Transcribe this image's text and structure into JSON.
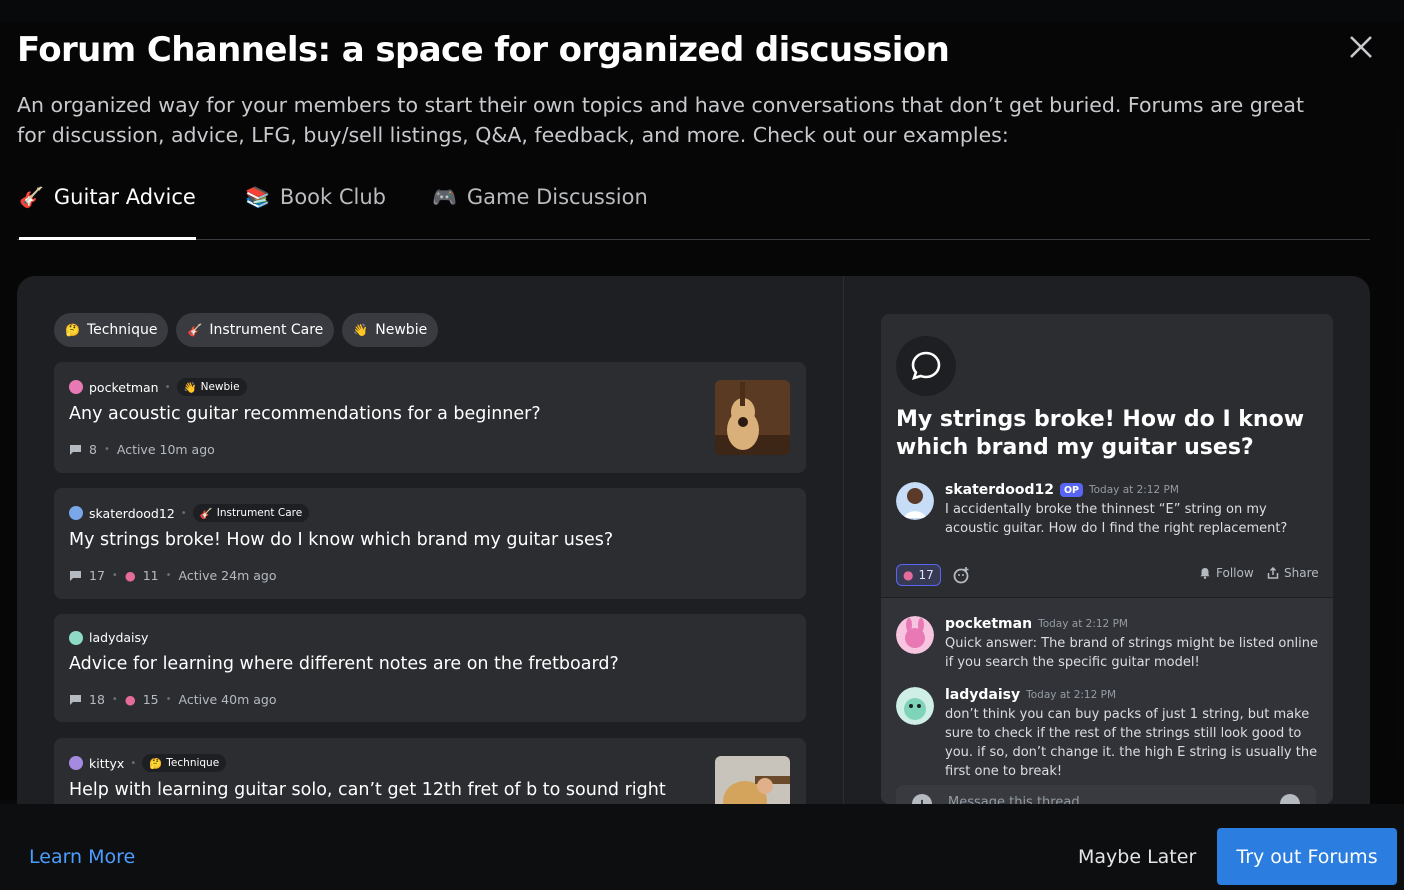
{
  "modal": {
    "title": "Forum Channels: a space for organized discussion",
    "subtitle": "An organized way for your members to start their own topics and have conversations that don’t get buried. Forums are great for discussion, advice, LFG, buy/sell listings, Q&A, feedback, and more. Check out our examples:"
  },
  "tabs": [
    {
      "label": "Guitar Advice",
      "icon": "guitar-icon",
      "glyph": "🎸",
      "active": true
    },
    {
      "label": "Book Club",
      "icon": "books-icon",
      "glyph": "📚",
      "active": false
    },
    {
      "label": "Game Discussion",
      "icon": "gamepad-icon",
      "glyph": "🎮",
      "active": false
    }
  ],
  "forum": {
    "tags": [
      {
        "label": "Technique",
        "glyph": "🤔",
        "icon": "thinking-face-icon"
      },
      {
        "label": "Instrument Care",
        "glyph": "🎸",
        "icon": "guitar-icon"
      },
      {
        "label": "Newbie",
        "glyph": "👋",
        "icon": "wave-icon"
      }
    ],
    "posts": [
      {
        "author": "pocketman",
        "tag": "Newbie",
        "tag_glyph": "👋",
        "title": "Any acoustic guitar recommendations for a beginner?",
        "messages": "8",
        "reactions": "",
        "activity": "Active 10m ago"
      },
      {
        "author": "skaterdood12",
        "tag": "Instrument Care",
        "tag_glyph": "🎸",
        "title": "My strings broke! How do I know which brand my guitar uses?",
        "messages": "17",
        "reactions": "11",
        "activity": "Active 24m ago"
      },
      {
        "author": "ladydaisy",
        "tag": "",
        "tag_glyph": "",
        "title": "Advice for learning where different notes are on the fretboard?",
        "messages": "18",
        "reactions": "15",
        "activity": "Active 40m ago"
      },
      {
        "author": "kittyx",
        "tag": "Technique",
        "tag_glyph": "🤔",
        "title": "Help with learning guitar solo, can’t get 12th fret of b to sound right",
        "messages": "",
        "reactions": "",
        "activity": ""
      }
    ]
  },
  "thread": {
    "title": "My strings broke! How do I know which brand my guitar uses?",
    "op": {
      "author": "skaterdood12",
      "badge": "OP",
      "time": "Today at 2:12 PM",
      "text": "I accidentally broke the thinnest “E” string on my acoustic guitar. How do I find the right replacement?"
    },
    "reaction_count": "17",
    "follow_label": "Follow",
    "share_label": "Share",
    "replies": [
      {
        "author": "pocketman",
        "time": "Today at 2:12 PM",
        "text": "Quick answer: The brand of strings might be listed online if you search the specific guitar model!"
      },
      {
        "author": "ladydaisy",
        "time": "Today at 2:12 PM",
        "text": "don’t think you can buy packs of just 1 string, but make sure to check if the rest of the strings still look good to you. if so, don’t change it. the high E string is usually the first one to break!"
      }
    ],
    "composer_placeholder": "Message this thread"
  },
  "footer": {
    "learn_more": "Learn More",
    "maybe_later": "Maybe Later",
    "try_forums": "Try out Forums"
  },
  "colors": {
    "accent": "#2b7de0",
    "link": "#4b9eff",
    "blurple": "#5865f2"
  }
}
